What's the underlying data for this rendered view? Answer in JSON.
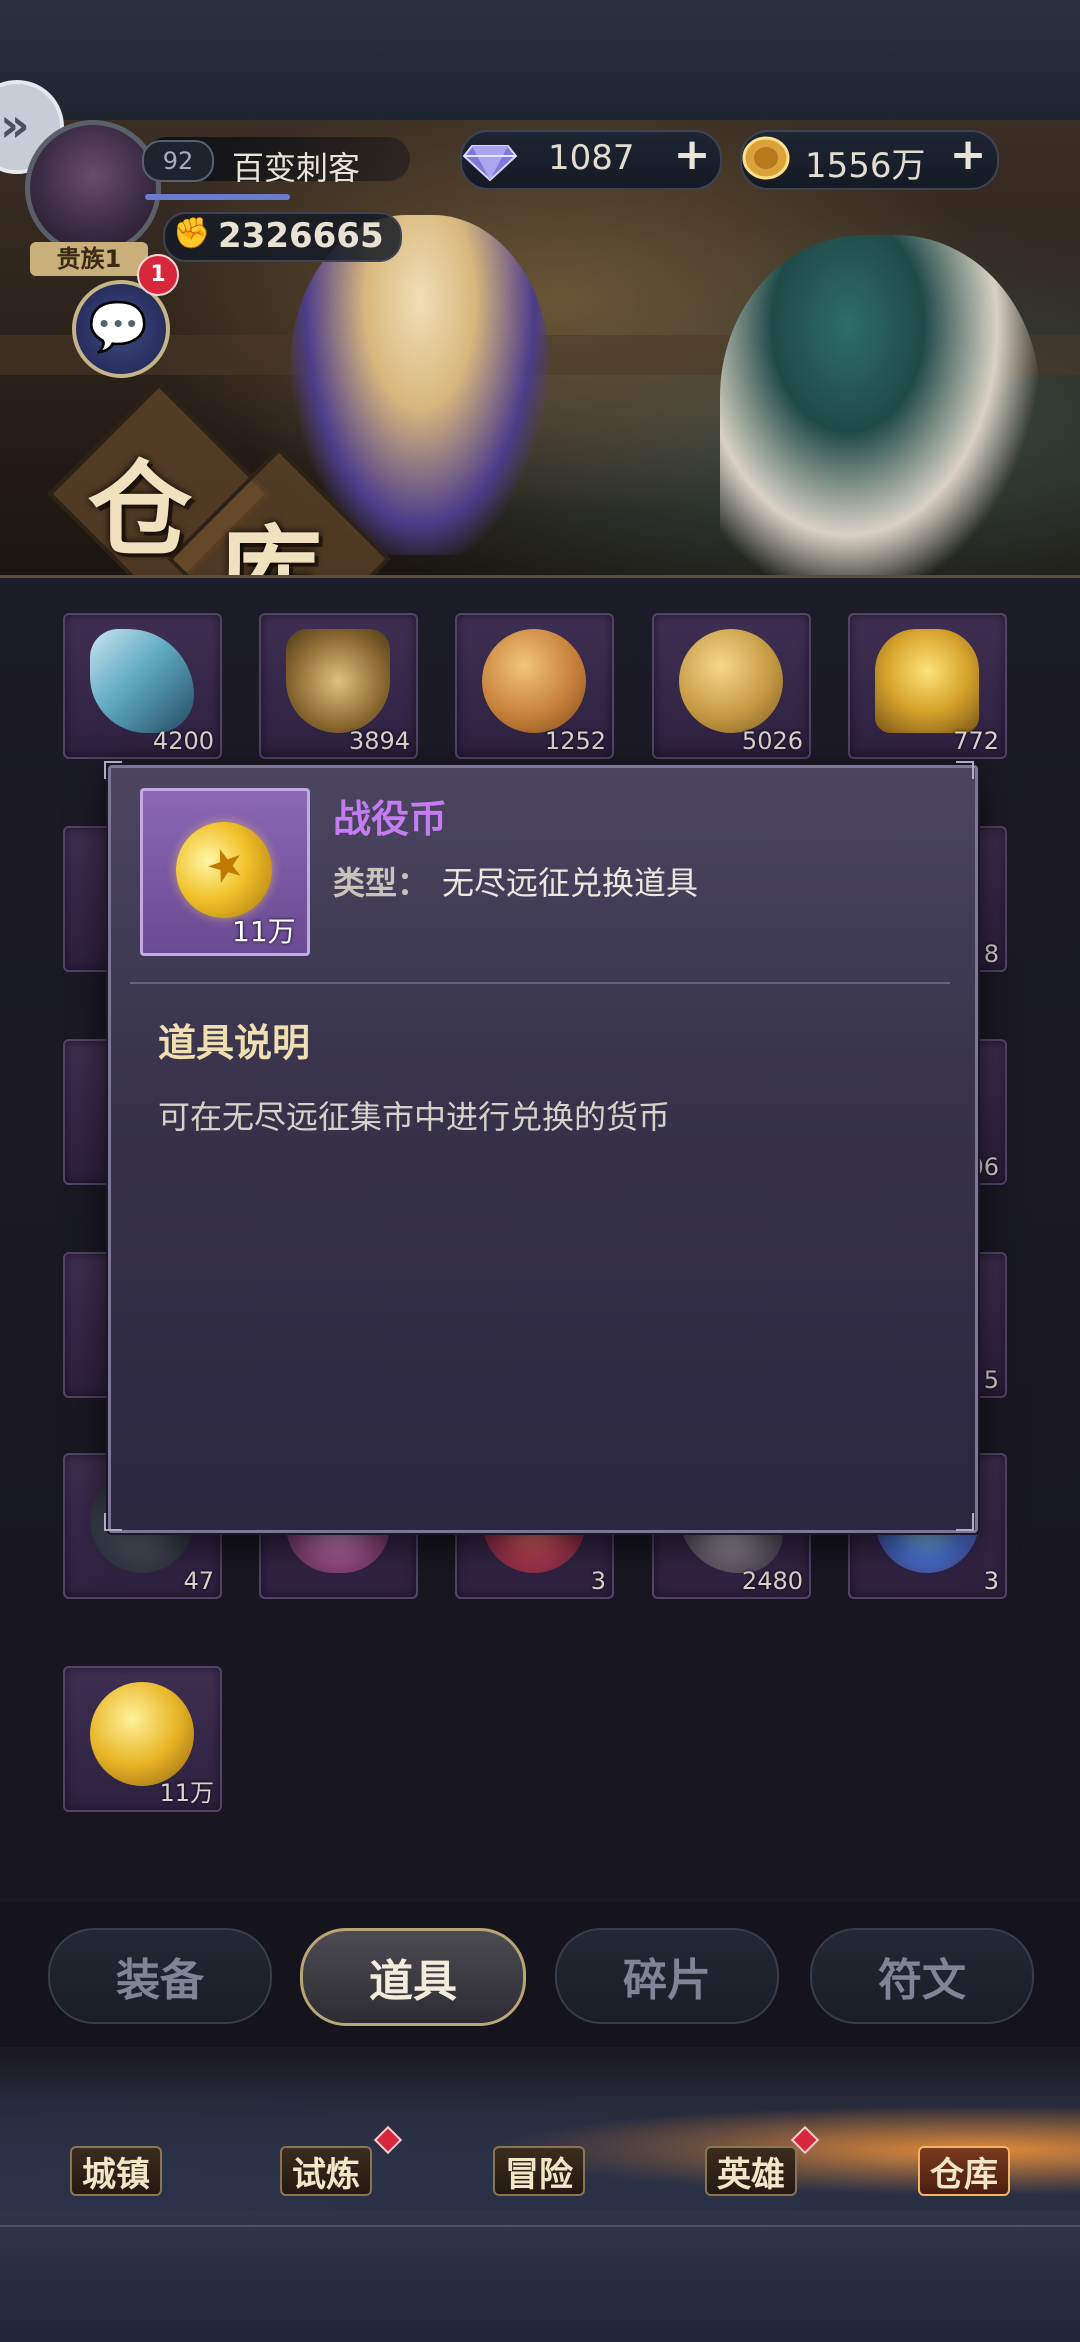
{
  "header": {
    "level": "92",
    "player_name": "百变刺客",
    "vip_label": "贵族1",
    "power": "2326665",
    "gems": "1087",
    "gold": "1556万",
    "chat_badge": "1"
  },
  "banner": {
    "title_chars": [
      "仓",
      "库"
    ]
  },
  "inventory": {
    "rows": [
      [
        {
          "icon": "crystal-shards",
          "count": "4200"
        },
        {
          "icon": "winged-emblem",
          "count": "3894"
        },
        {
          "icon": "bronze-arrow-coin",
          "count": "1252"
        },
        {
          "icon": "star-coin",
          "count": "5026"
        },
        {
          "icon": "golden-trophy",
          "count": "772"
        }
      ],
      [
        {
          "icon": "hidden-item",
          "count": ""
        },
        {
          "icon": "hidden-item",
          "count": ""
        },
        {
          "icon": "hidden-item",
          "count": ""
        },
        {
          "icon": "hidden-item",
          "count": ""
        },
        {
          "icon": "hidden-item",
          "count": "8"
        }
      ],
      [
        {
          "icon": "hidden-item",
          "count": ""
        },
        {
          "icon": "hidden-item",
          "count": ""
        },
        {
          "icon": "hidden-item",
          "count": ""
        },
        {
          "icon": "hidden-item",
          "count": ""
        },
        {
          "icon": "hidden-item",
          "count": "06"
        }
      ],
      [
        {
          "icon": "hidden-item",
          "count": ""
        },
        {
          "icon": "hidden-item",
          "count": ""
        },
        {
          "icon": "hidden-item",
          "count": ""
        },
        {
          "icon": "hidden-item",
          "count": ""
        },
        {
          "icon": "hidden-item",
          "count": "5"
        }
      ],
      [
        {
          "icon": "dark-orb",
          "count": "47"
        },
        {
          "icon": "pink-crystal",
          "count": ""
        },
        {
          "icon": "red-stone",
          "count": "3"
        },
        {
          "icon": "grey-rock",
          "count": "2480"
        },
        {
          "icon": "blue-gem",
          "count": "3"
        }
      ],
      [
        {
          "icon": "campaign-coin",
          "count": "11万"
        }
      ]
    ]
  },
  "popup": {
    "item_name": "战役币",
    "item_count": "11万",
    "type_label": "类型：",
    "type_value": "无尽远征兑换道具",
    "desc_title": "道具说明",
    "desc_text": "可在无尽远征集市中进行兑换的货币"
  },
  "tabs": [
    {
      "label": "装备",
      "active": false
    },
    {
      "label": "道具",
      "active": true
    },
    {
      "label": "碎片",
      "active": false
    },
    {
      "label": "符文",
      "active": false
    }
  ],
  "bottom_nav": [
    {
      "label": "城镇",
      "badge": false
    },
    {
      "label": "试炼",
      "badge": true
    },
    {
      "label": "冒险",
      "badge": false
    },
    {
      "label": "英雄",
      "badge": true
    },
    {
      "label": "仓库",
      "badge": false,
      "active": true
    }
  ],
  "colors": {
    "item_name": "#c47cf0",
    "desc_title": "#f0dfb0",
    "slot_bg": "#3f2f52",
    "popup_bg": "#37324a",
    "badge_red": "#d8263a"
  }
}
